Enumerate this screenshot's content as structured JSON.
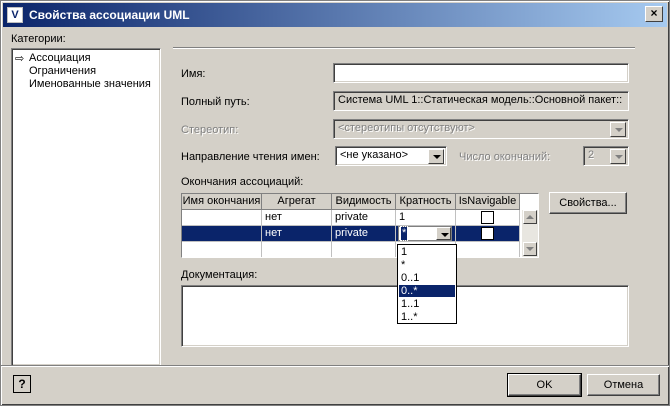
{
  "window": {
    "title": "Свойства ассоциации UML",
    "icon_glyph": "V",
    "close_glyph": "×"
  },
  "categories": {
    "label": "Категории:",
    "items": [
      "Ассоциация",
      "Ограничения",
      "Именованные значения"
    ],
    "selected_marker": "⇨"
  },
  "form": {
    "name_label": "Имя:",
    "name_value": "",
    "fullpath_label": "Полный путь:",
    "fullpath_value": "Система UML 1::Статическая модель::Основной пакет::",
    "stereotype_label": "Стереотип:",
    "stereotype_value": "<стереотипы отсутствуют>",
    "direction_label": "Направление чтения имен:",
    "direction_value": "<не указано>",
    "ends_count_label": "Число окончаний:",
    "ends_count_value": "2"
  },
  "ends": {
    "label": "Окончания ассоциаций:",
    "columns": [
      "Имя окончания",
      "Агрегат",
      "Видимость",
      "Кратность",
      "IsNavigable"
    ],
    "rows": [
      {
        "name": "",
        "aggregate": "нет",
        "visibility": "private",
        "multiplicity": "1",
        "navigable": false
      },
      {
        "name": "",
        "aggregate": "нет",
        "visibility": "private",
        "multiplicity": "*",
        "navigable": false
      }
    ],
    "properties_button": "Свойства...",
    "multiplicity_options": [
      "1",
      "*",
      "0..1",
      "0..*",
      "1..1",
      "1..*"
    ],
    "multiplicity_highlighted": "0..*"
  },
  "documentation": {
    "label": "Документация:",
    "value": ""
  },
  "buttons": {
    "ok": "OK",
    "cancel": "Отмена",
    "help_glyph": "?"
  }
}
